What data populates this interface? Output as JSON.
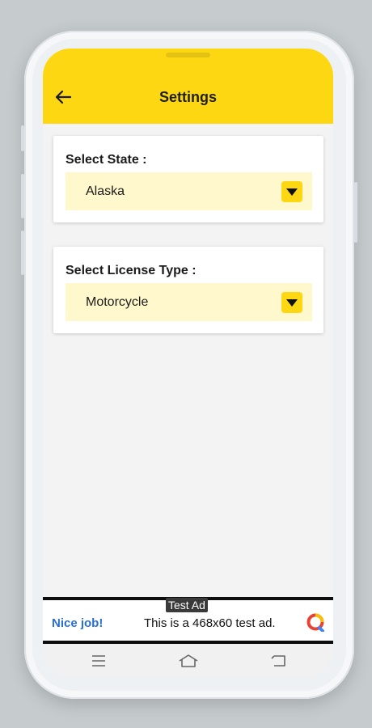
{
  "app_bar": {
    "title": "Settings",
    "back_icon": "arrow-left-icon",
    "background_color": "#fdd712"
  },
  "cards": [
    {
      "label": "Select State :",
      "value": "Alaska",
      "icon": "dropdown-triangle-icon"
    },
    {
      "label": "Select License Type :",
      "value": "Motorcycle",
      "icon": "dropdown-triangle-icon"
    }
  ],
  "ad": {
    "tag": "Test Ad",
    "cta": "Nice job!",
    "text": "This is a 468x60 test ad.",
    "logo_icon": "ad-network-logo-icon"
  },
  "nav": {
    "items": [
      {
        "name": "menu",
        "icon": "menu-icon"
      },
      {
        "name": "home",
        "icon": "home-icon"
      },
      {
        "name": "back",
        "icon": "back-icon"
      }
    ]
  },
  "colors": {
    "accent": "#fdd712",
    "dropdown_bg": "#fef8cc",
    "link_blue": "#2a6fd2"
  }
}
